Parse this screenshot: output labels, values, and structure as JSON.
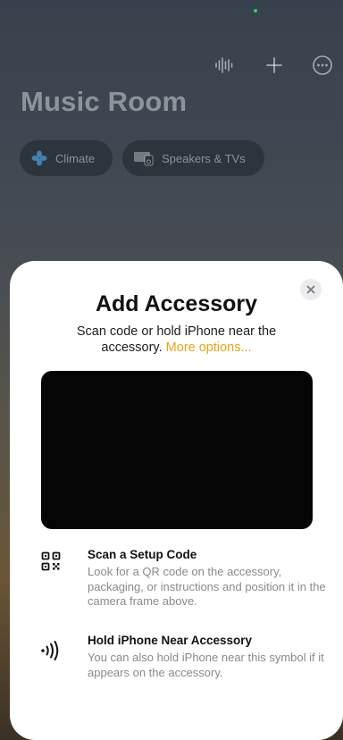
{
  "background": {
    "room_title": "Music Room",
    "chips": [
      {
        "label": "Climate",
        "icon": "fan-icon",
        "color": "#4a8fc0"
      },
      {
        "label": "Speakers & TVs",
        "icon": "speaker-tv-icon"
      }
    ],
    "toolbar_icons": [
      "siri-waveform-icon",
      "plus-icon",
      "more-icon"
    ]
  },
  "sheet": {
    "title": "Add Accessory",
    "subtitle": "Scan code or hold iPhone near the accessory.",
    "more_options": "More options...",
    "accent_color": "#e3a51a",
    "options": [
      {
        "icon": "qr-code-icon",
        "title": "Scan a Setup Code",
        "description": "Look for a QR code on the accessory, packaging, or instructions and position it in the camera frame above."
      },
      {
        "icon": "nfc-icon",
        "title": "Hold iPhone Near Accessory",
        "description": "You can also hold iPhone near this symbol if it appears on the accessory."
      }
    ]
  }
}
